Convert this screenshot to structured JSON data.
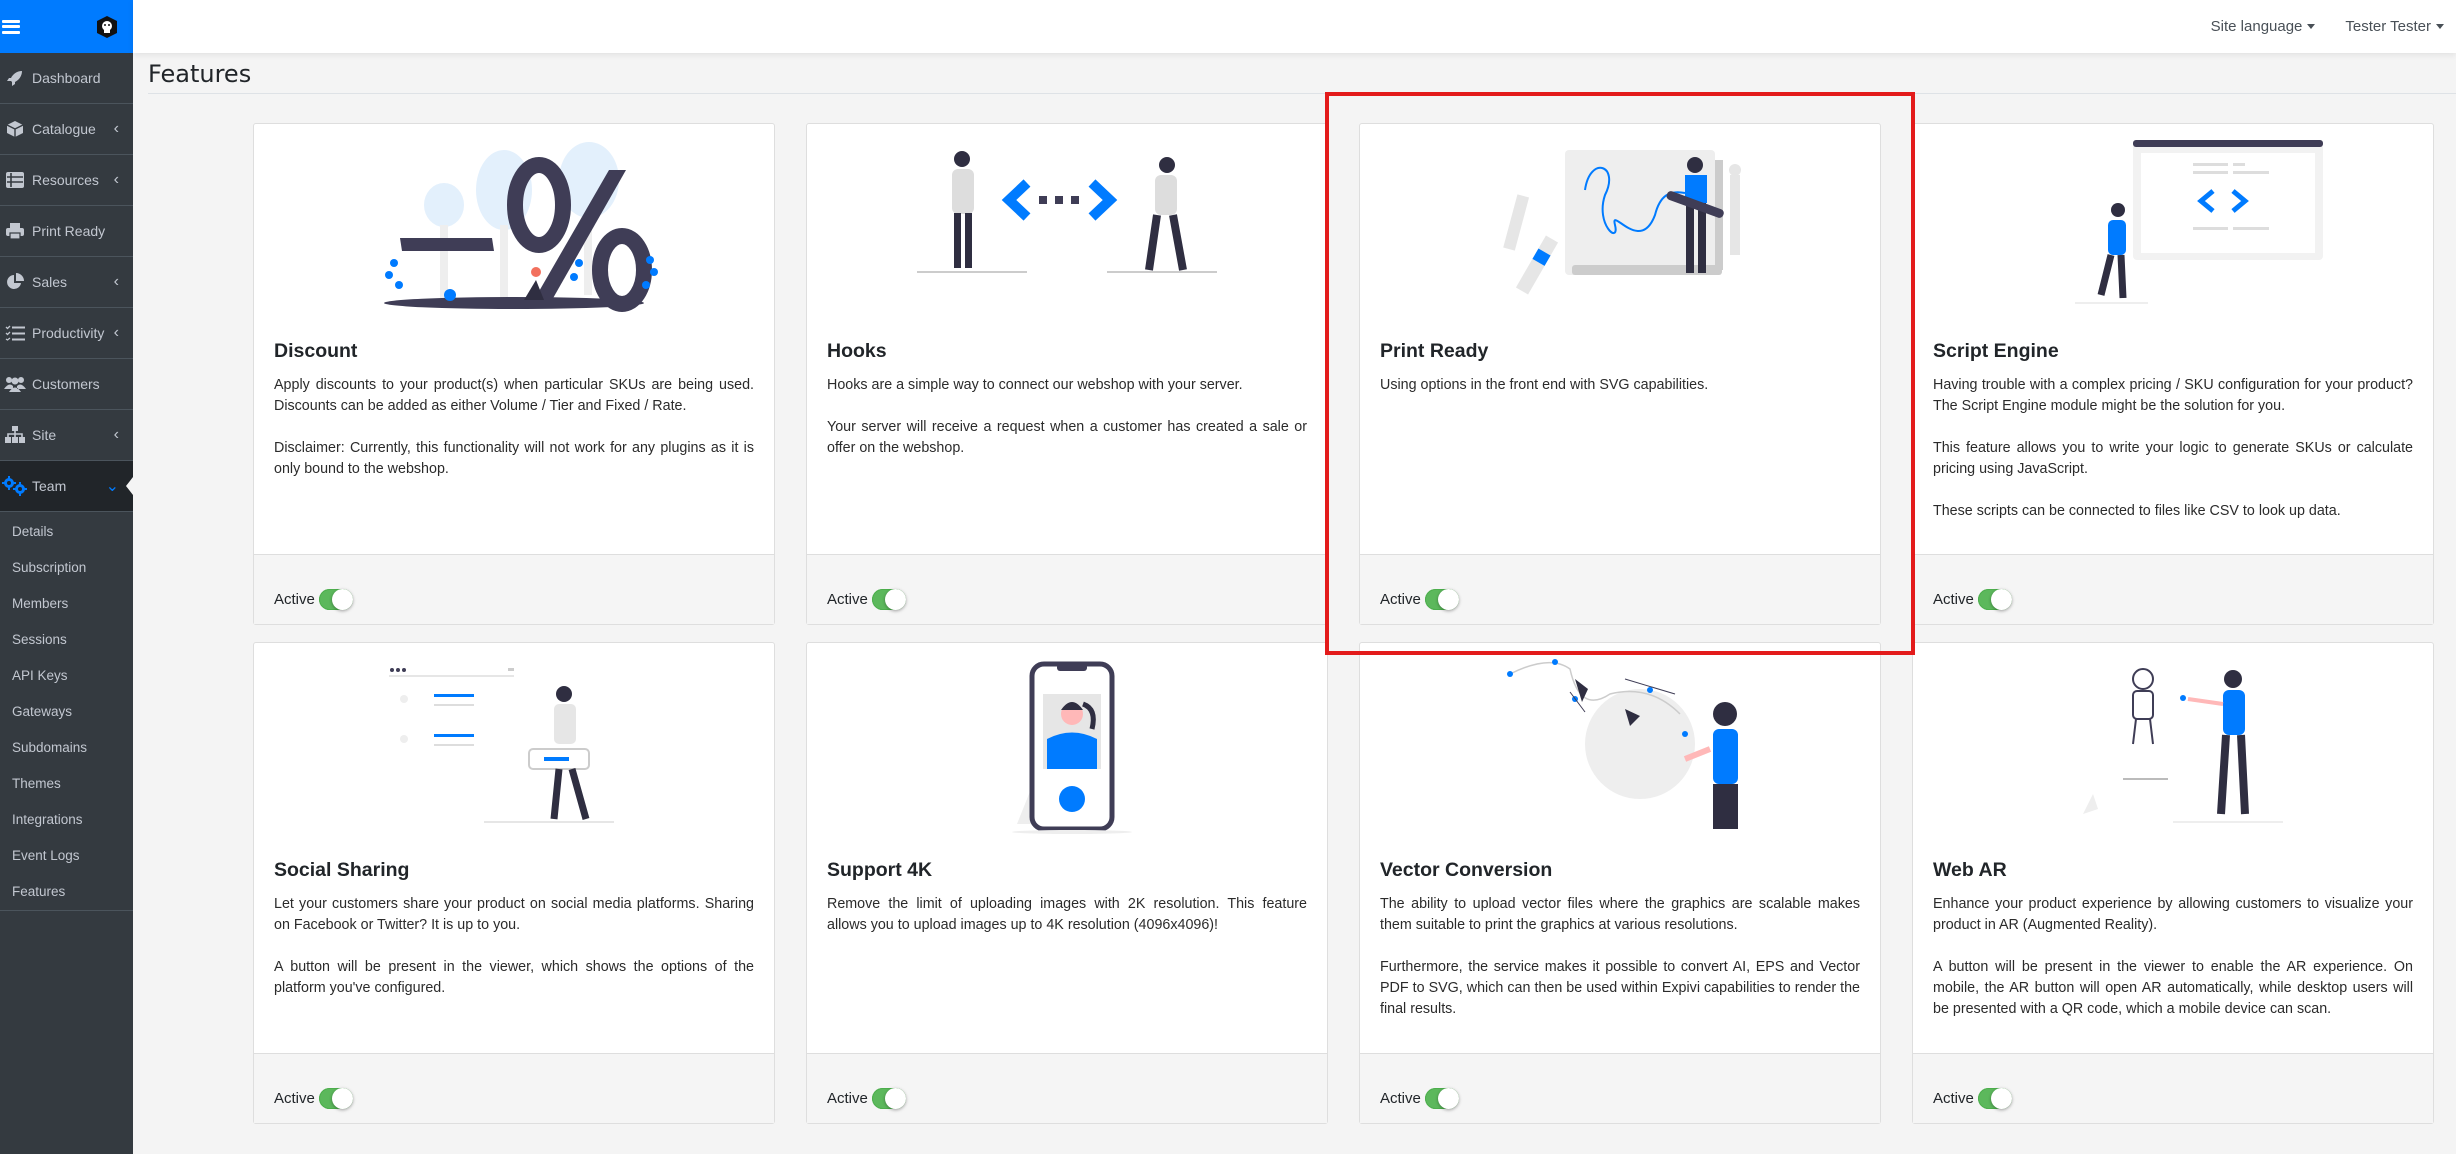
{
  "sidebar": {
    "items": [
      {
        "label": "Dashboard",
        "icon": "rocket-icon",
        "has_arrow": false
      },
      {
        "label": "Catalogue",
        "icon": "box-icon",
        "has_arrow": true
      },
      {
        "label": "Resources",
        "icon": "list-icon",
        "has_arrow": true
      },
      {
        "label": "Print Ready",
        "icon": "printer-icon",
        "has_arrow": false
      },
      {
        "label": "Sales",
        "icon": "pie-chart-icon",
        "has_arrow": true
      },
      {
        "label": "Productivity",
        "icon": "tasks-icon",
        "has_arrow": true
      },
      {
        "label": "Customers",
        "icon": "users-icon",
        "has_arrow": false
      },
      {
        "label": "Site",
        "icon": "sitemap-icon",
        "has_arrow": true
      },
      {
        "label": "Team",
        "icon": "cogs-icon",
        "has_arrow": true,
        "open": true
      }
    ],
    "team_subitems": [
      "Details",
      "Subscription",
      "Members",
      "Sessions",
      "API Keys",
      "Gateways",
      "Subdomains",
      "Themes",
      "Integrations",
      "Event Logs",
      "Features"
    ],
    "arrow_glyph": "‹",
    "open_arrow_glyph": "⌄"
  },
  "topbar": {
    "site_language": "Site language",
    "user": "Tester Tester"
  },
  "page": {
    "title": "Features"
  },
  "colors": {
    "brand": "#007bff",
    "sidebar_bg": "#343a40",
    "toggle_on": "#5cb85c",
    "highlight": "#e31b1b"
  },
  "features": [
    {
      "title": "Discount",
      "illustration": "discount-illustration",
      "paragraphs": [
        "Apply discounts to your product(s) when particular SKUs are being used. Discounts can be added as either Volume / Tier and Fixed / Rate.",
        "Disclaimer: Currently, this functionality will not work for any plugins as it is only bound to the webshop."
      ],
      "status_label": "Active",
      "active": true
    },
    {
      "title": "Hooks",
      "illustration": "hooks-illustration",
      "paragraphs": [
        "Hooks are a simple way to connect our webshop with your server.",
        "Your server will receive a request when a customer has created a sale or offer on the webshop."
      ],
      "status_label": "Active",
      "active": true
    },
    {
      "title": "Print Ready",
      "illustration": "print-ready-illustration",
      "paragraphs": [
        "Using options in the front end with SVG capabilities."
      ],
      "status_label": "Active",
      "active": true,
      "highlighted": true
    },
    {
      "title": "Script Engine",
      "illustration": "script-engine-illustration",
      "paragraphs": [
        "Having trouble with a complex pricing / SKU configuration for your product? The Script Engine module might be the solution for you.",
        "This feature allows you to write your logic to generate SKUs or calculate pricing using JavaScript.",
        "These scripts can be connected to files like CSV to look up data."
      ],
      "status_label": "Active",
      "active": true
    },
    {
      "title": "Social Sharing",
      "illustration": "social-sharing-illustration",
      "paragraphs": [
        "Let your customers share your product on social media platforms. Sharing on Facebook or Twitter? It is up to you.",
        "A button will be present in the viewer, which shows the options of the platform you've configured."
      ],
      "status_label": "Active",
      "active": true
    },
    {
      "title": "Support 4K",
      "illustration": "support-4k-illustration",
      "paragraphs": [
        "Remove the limit of uploading images with 2K resolution. This feature allows you to upload images up to 4K resolution (4096x4096)!"
      ],
      "status_label": "Active",
      "active": true
    },
    {
      "title": "Vector Conversion",
      "illustration": "vector-conversion-illustration",
      "paragraphs": [
        "The ability to upload vector files where the graphics are scalable makes them suitable to print the graphics at various resolutions.",
        "Furthermore, the service makes it possible to convert AI, EPS and Vector PDF to SVG, which can then be used within Expivi capabilities to render the final results."
      ],
      "status_label": "Active",
      "active": true
    },
    {
      "title": "Web AR",
      "illustration": "web-ar-illustration",
      "paragraphs": [
        "Enhance your product experience by allowing customers to visualize your product in AR (Augmented Reality).",
        "A button will be present in the viewer to enable the AR experience. On mobile, the AR button will open AR automatically, while desktop users will be presented with a QR code, which a mobile device can scan."
      ],
      "status_label": "Active",
      "active": true
    }
  ]
}
